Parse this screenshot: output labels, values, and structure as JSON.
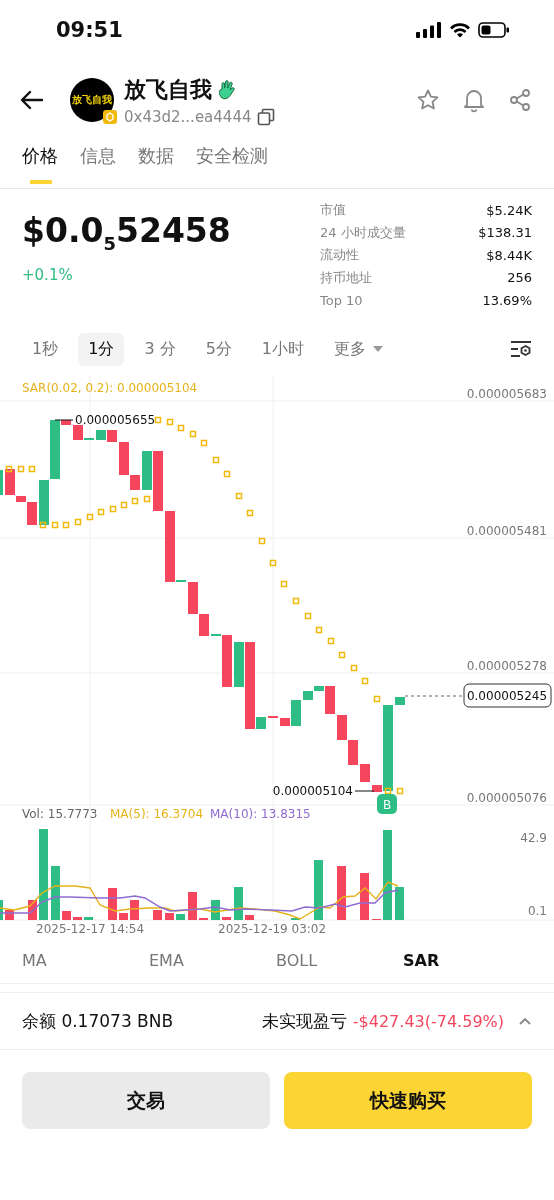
{
  "status_bar": {
    "time": "09:51"
  },
  "header": {
    "token_name": "放飞自我",
    "avatar_text": "放飞自我",
    "address": "0x43d2...ea4444"
  },
  "tabs": [
    {
      "label": "价格",
      "selected": true
    },
    {
      "label": "信息",
      "selected": false
    },
    {
      "label": "数据",
      "selected": false
    },
    {
      "label": "安全检测",
      "selected": false
    }
  ],
  "price": {
    "value": "$0.0$_{5}$52458",
    "change": "+0.1%"
  },
  "stats": [
    {
      "label": "市值",
      "value": "$5.24K"
    },
    {
      "label": "24 小时成交量",
      "value": "$138.31"
    },
    {
      "label": "流动性",
      "value": "$8.44K"
    },
    {
      "label": "持币地址",
      "value": "256"
    },
    {
      "label": "Top 10",
      "value": "13.69%"
    }
  ],
  "intervals": [
    {
      "label": "1秒",
      "kind": "interval",
      "selected": false
    },
    {
      "label": "1分",
      "kind": "interval",
      "selected": true
    },
    {
      "label": "3 分",
      "kind": "interval",
      "selected": false
    },
    {
      "label": "5分",
      "kind": "interval",
      "selected": false
    },
    {
      "label": "1小时",
      "kind": "interval",
      "selected": false
    },
    {
      "label": "更多",
      "kind": "dropdown",
      "selected": false
    }
  ],
  "chart": {
    "indicator_label": "SAR(0.02, 0.2): 0.000005104",
    "y_ticks": [
      "0.000005683",
      "0.000005481",
      "0.000005278",
      "0.000005076"
    ],
    "high_label": "0.000005655",
    "low_label": "0.000005104",
    "current_price": "0.000005245",
    "signal": "B",
    "volume": {
      "vol": "Vol: 15.7773",
      "ma5": "MA(5): 16.3704",
      "ma10": "MA(10): 13.8315",
      "y_ticks": [
        "42.9",
        "0.1"
      ]
    },
    "dates": [
      "2025-12-17 14:54",
      "2025-12-19 03:02"
    ]
  },
  "indicators": [
    {
      "label": "MA",
      "selected": false
    },
    {
      "label": "EMA",
      "selected": false
    },
    {
      "label": "BOLL",
      "selected": false
    },
    {
      "label": "SAR",
      "selected": true
    }
  ],
  "balance": {
    "label": "余额 0.17073 BNB",
    "pnl_label": "未实现盈亏",
    "pnl_value": "-$427.43(-74.59%)"
  },
  "buttons": [
    {
      "label": "交易",
      "kind": "secondary"
    },
    {
      "label": "快速购买",
      "kind": "primary"
    }
  ]
}
